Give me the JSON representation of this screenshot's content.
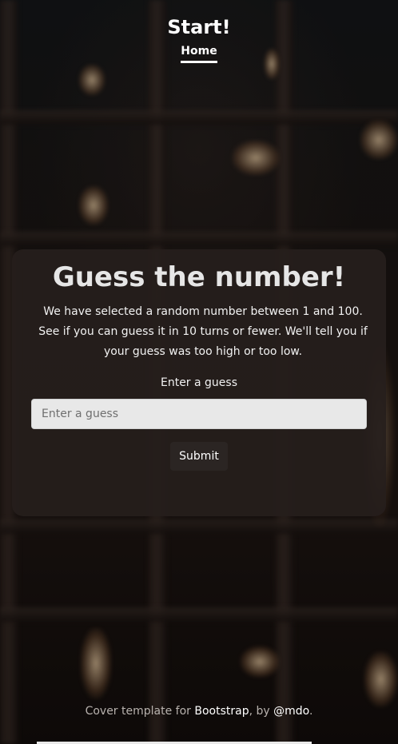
{
  "header": {
    "brand": "Start!",
    "nav": [
      {
        "label": "Home",
        "active": true
      }
    ]
  },
  "main": {
    "title": "Guess the number!",
    "lead": "We have selected a random number between 1 and 100. See if you can guess it in 10 turns or fewer. We'll tell you if your guess was too high or too low.",
    "guess_label": "Enter a guess",
    "guess_input": {
      "value": "",
      "placeholder": "Enter a guess"
    },
    "submit_label": "Submit"
  },
  "footer": {
    "prefix": "Cover template for ",
    "bootstrap_link": "Bootstrap",
    "middle": ", by ",
    "author_link": "@mdo",
    "suffix": "."
  },
  "colors": {
    "card_background": "#261e1c",
    "input_background": "#e8e8e8",
    "text": "#ffffff",
    "footer_text": "#b8b2ae"
  }
}
